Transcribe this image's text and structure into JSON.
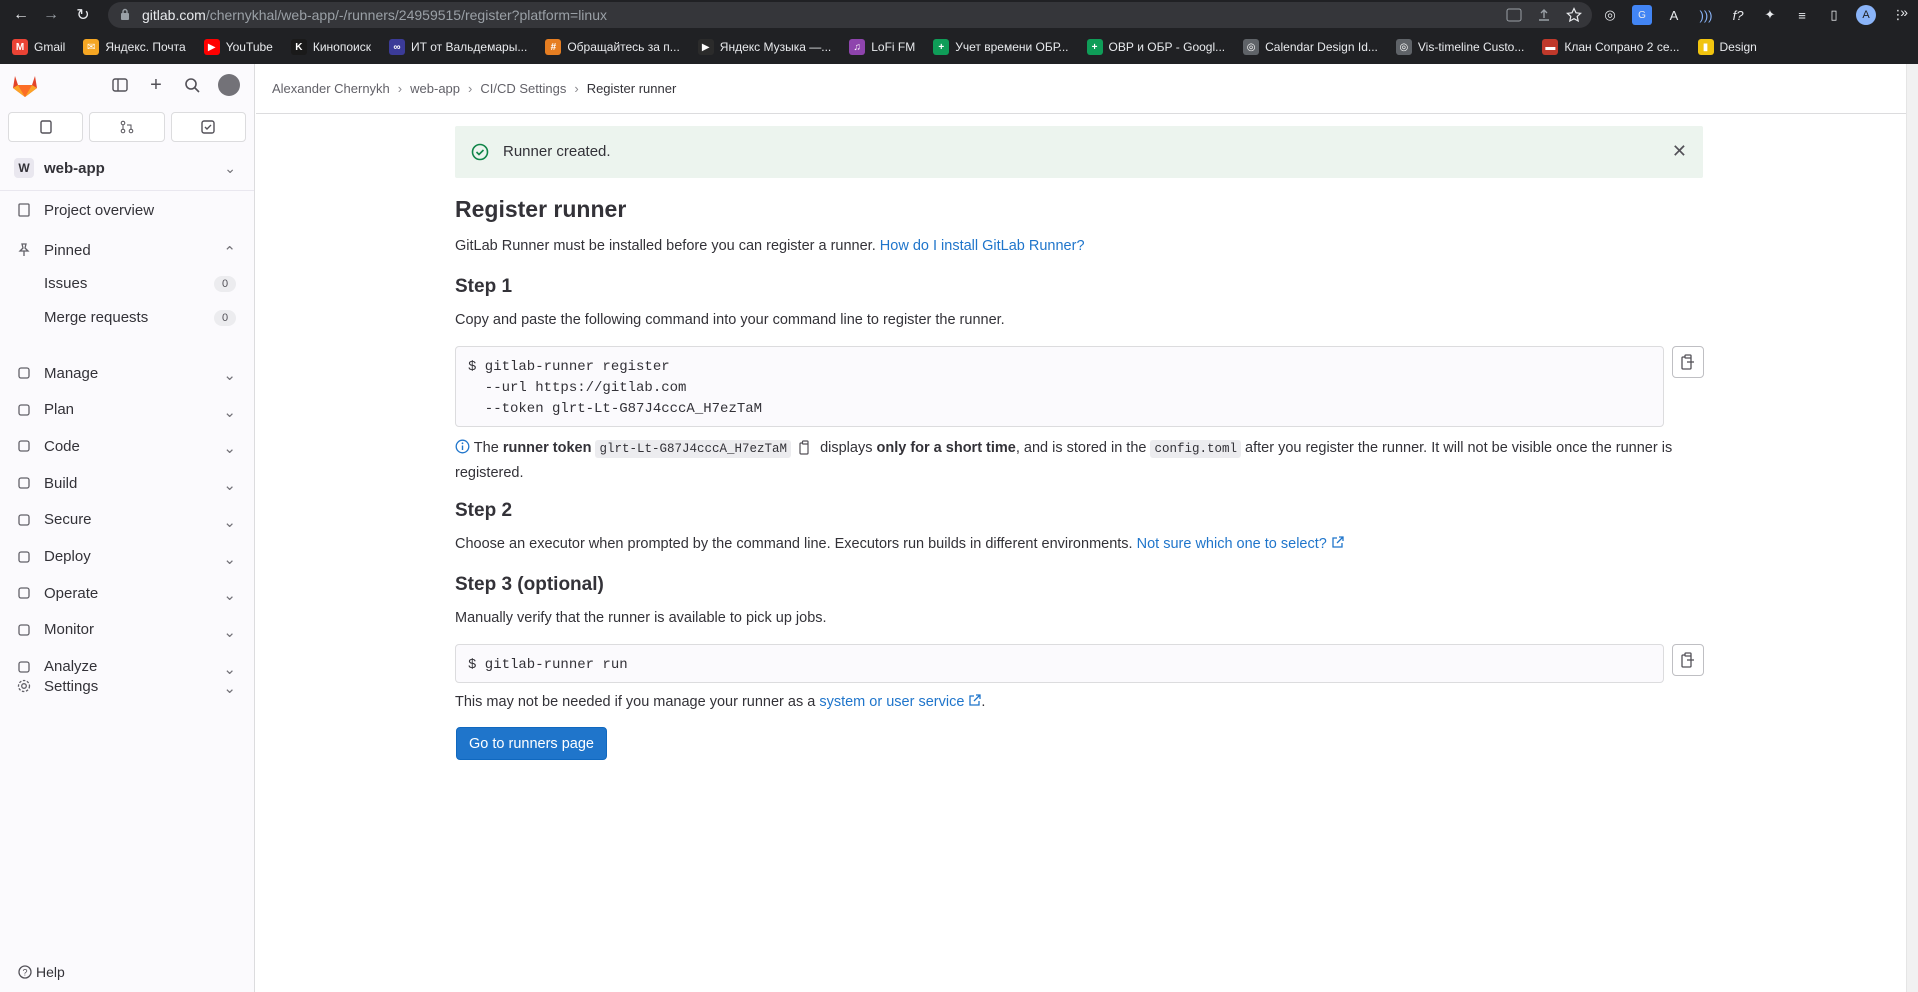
{
  "browser": {
    "url_host": "gitlab.com",
    "url_path": "/chernykhal/web-app/-/runners/24959515/register?platform=linux",
    "bookmarks": [
      {
        "label": "Gmail",
        "color": "#ea4335",
        "glyph": "M"
      },
      {
        "label": "Яндекс. Почта",
        "color": "#f5a623",
        "glyph": "✉"
      },
      {
        "label": "YouTube",
        "color": "#ff0000",
        "glyph": "▶"
      },
      {
        "label": "Кинопоиск",
        "color": "#1a1a1a",
        "glyph": "K"
      },
      {
        "label": "ИТ от Вальдемары...",
        "color": "#3b3b98",
        "glyph": "∞"
      },
      {
        "label": "Обращайтесь за п...",
        "color": "#e67e22",
        "glyph": "#"
      },
      {
        "label": "Яндекс Музыка —...",
        "color": "#2b2b2b",
        "glyph": "▶"
      },
      {
        "label": "LoFi FM",
        "color": "#8e44ad",
        "glyph": "♫"
      },
      {
        "label": "Учет времени ОБР...",
        "color": "#0f9d58",
        "glyph": "+"
      },
      {
        "label": "ОВР и ОБР - Googl...",
        "color": "#0f9d58",
        "glyph": "+"
      },
      {
        "label": "Calendar Design Id...",
        "color": "#5f6368",
        "glyph": "◎"
      },
      {
        "label": "Vis-timeline Custo...",
        "color": "#5f6368",
        "glyph": "◎"
      },
      {
        "label": "Клан Сопрано 2 се...",
        "color": "#c0392b",
        "glyph": "▬"
      },
      {
        "label": "Design",
        "color": "#f1c40f",
        "glyph": "▮"
      }
    ],
    "profile_initial": "A"
  },
  "sidebar": {
    "project_initial": "W",
    "project_name": "web-app",
    "overview": "Project overview",
    "pinned": "Pinned",
    "issues": "Issues",
    "issues_count": "0",
    "merge_requests": "Merge requests",
    "mr_count": "0",
    "items": [
      "Manage",
      "Plan",
      "Code",
      "Build",
      "Secure",
      "Deploy",
      "Operate",
      "Monitor",
      "Analyze"
    ],
    "settings": "Settings",
    "help": "Help"
  },
  "breadcrumb": [
    "Alexander Chernykh",
    "web-app",
    "CI/CD Settings",
    "Register runner"
  ],
  "alert": {
    "text": "Runner created.",
    "color": "#108548"
  },
  "page": {
    "title": "Register runner",
    "intro": "GitLab Runner must be installed before you can register a runner.",
    "intro_link": "How do I install GitLab Runner?",
    "step1_title": "Step 1",
    "step1_desc": "Copy and paste the following command into your command line to register the runner.",
    "step1_code": "$ gitlab-runner register\n  --url https://gitlab.com\n  --token glrt-Lt-G87J4cccA_H7ezTaM",
    "token_note": {
      "the": "The",
      "runner_token": "runner token",
      "token": "glrt-Lt-G87J4cccA_H7ezTaM",
      "displays": "displays",
      "short_time": "only for a short time",
      "stored": ", and is stored in the",
      "file": "config.toml",
      "after": "after you register the runner. It will not be visible once the runner is",
      "registered": "registered."
    },
    "step2_title": "Step 2",
    "step2_desc": "Choose an executor when prompted by the command line. Executors run builds in different environments.",
    "step2_link": "Not sure which one to select?",
    "step3_title": "Step 3 (optional)",
    "step3_desc": "Manually verify that the runner is available to pick up jobs.",
    "step3_code": "$ gitlab-runner run",
    "service_note": "This may not be needed if you manage your runner as a",
    "service_link": "system or user service",
    "service_end": ".",
    "button": "Go to runners page"
  }
}
